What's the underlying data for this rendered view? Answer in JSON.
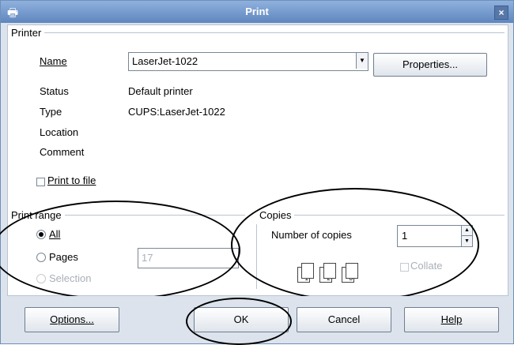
{
  "window": {
    "title": "Print",
    "close_glyph": "×"
  },
  "printer": {
    "section_label": "Printer",
    "name_label": "Name",
    "name_value": "LaserJet-1022",
    "properties_button": "Properties...",
    "status_label": "Status",
    "status_value": "Default printer",
    "type_label": "Type",
    "type_value": "CUPS:LaserJet-1022",
    "location_label": "Location",
    "location_value": "",
    "comment_label": "Comment",
    "comment_value": "",
    "print_to_file_label": "Print to file",
    "print_to_file_checked": false
  },
  "print_range": {
    "section_label": "Print range",
    "all_label": "All",
    "pages_label": "Pages",
    "pages_value": "17",
    "selection_label": "Selection",
    "selected": "All"
  },
  "copies": {
    "section_label": "Copies",
    "number_label": "Number of copies",
    "number_value": "1",
    "collate_label": "Collate",
    "collate_checked": false,
    "page_numbers": [
      "1",
      "2",
      "3"
    ]
  },
  "buttons": {
    "options": "Options...",
    "ok": "OK",
    "cancel": "Cancel",
    "help": "Help"
  },
  "colors": {
    "titlebar": "#5f86bd",
    "dialog_bg": "#dce3ec"
  },
  "icons": [
    "printer-icon",
    "close-icon",
    "dropdown-arrow-icon",
    "spin-up-icon",
    "spin-down-icon",
    "collate-pages-icon"
  ]
}
